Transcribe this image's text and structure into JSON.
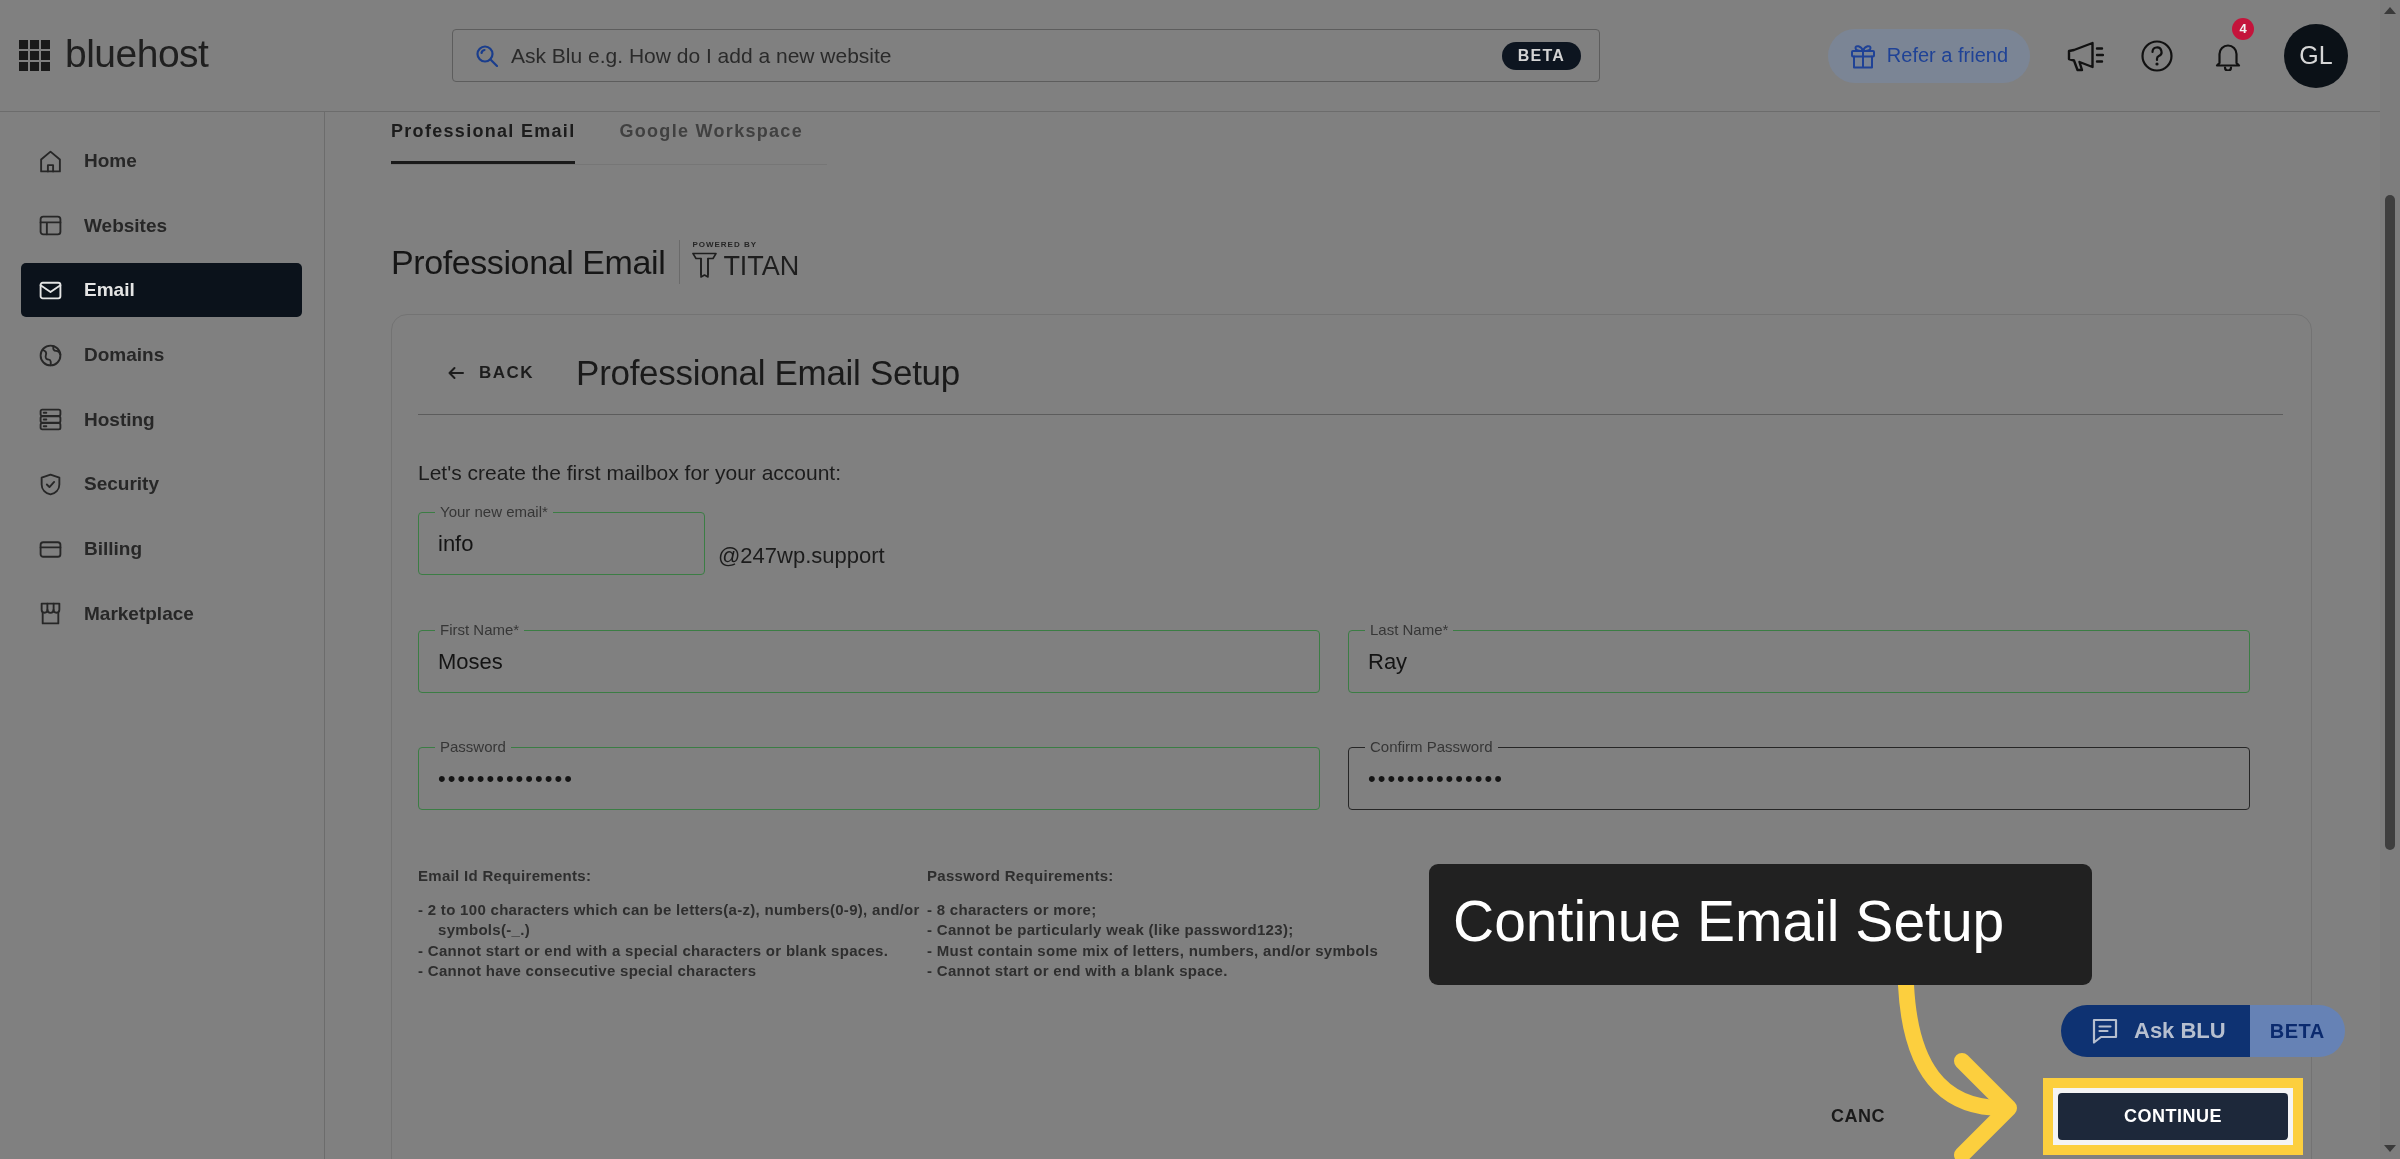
{
  "header": {
    "logo": "bluehost",
    "search": {
      "placeholder": "Ask Blu e.g. How do I add a new website",
      "badge": "BETA"
    },
    "refer_button": "Refer a friend",
    "notification_count": "4",
    "avatar_initials": "GL"
  },
  "sidebar": {
    "items": [
      {
        "label": "Home",
        "selected": false
      },
      {
        "label": "Websites",
        "selected": false
      },
      {
        "label": "Email",
        "selected": true
      },
      {
        "label": "Domains",
        "selected": false
      },
      {
        "label": "Hosting",
        "selected": false
      },
      {
        "label": "Security",
        "selected": false
      },
      {
        "label": "Billing",
        "selected": false
      },
      {
        "label": "Marketplace",
        "selected": false
      }
    ]
  },
  "tabs": [
    {
      "label": "Professional Email",
      "selected": true
    },
    {
      "label": "Google Workspace",
      "selected": false
    }
  ],
  "page_title": "Professional Email",
  "powered_by": {
    "caption": "POWERED BY",
    "brand": "TITAN"
  },
  "setup": {
    "back_button": "BACK",
    "title": "Professional Email Setup",
    "intro": "Let's create the first mailbox for your account:",
    "email_field": {
      "label": "Your new email*",
      "value": "info",
      "valid": true
    },
    "domain_suffix": "@247wp.support",
    "fields": [
      {
        "label": "First Name*",
        "value": "Moses",
        "valid": true
      },
      {
        "label": "Last Name*",
        "value": "Ray",
        "valid": true
      },
      {
        "label": "Password",
        "value": "••••••••••••••",
        "valid": true
      },
      {
        "label": "Confirm Password",
        "value": "••••••••••••••",
        "valid": false
      }
    ],
    "requirements": [
      {
        "title": "Email Id Requirements:",
        "items": [
          "- 2 to 100 characters which can be letters(a-z), numbers(0-9), and/or symbols(-_.)",
          "- Cannot start or end with a special characters or blank spaces.",
          "- Cannot have consecutive special characters"
        ]
      },
      {
        "title": "Password Requirements:",
        "items": [
          "- 8 characters or more;",
          "- Cannot be particularly weak (like password123);",
          "- Must contain some mix of letters, numbers, and/or symbols",
          "- Cannot start or end with a blank space."
        ]
      }
    ],
    "cancel_button": "CANC",
    "continue_button": "CONTINUE"
  },
  "ask_blu": {
    "label": "Ask BLU",
    "badge": "BETA"
  },
  "callout": {
    "text": "Continue Email Setup"
  }
}
